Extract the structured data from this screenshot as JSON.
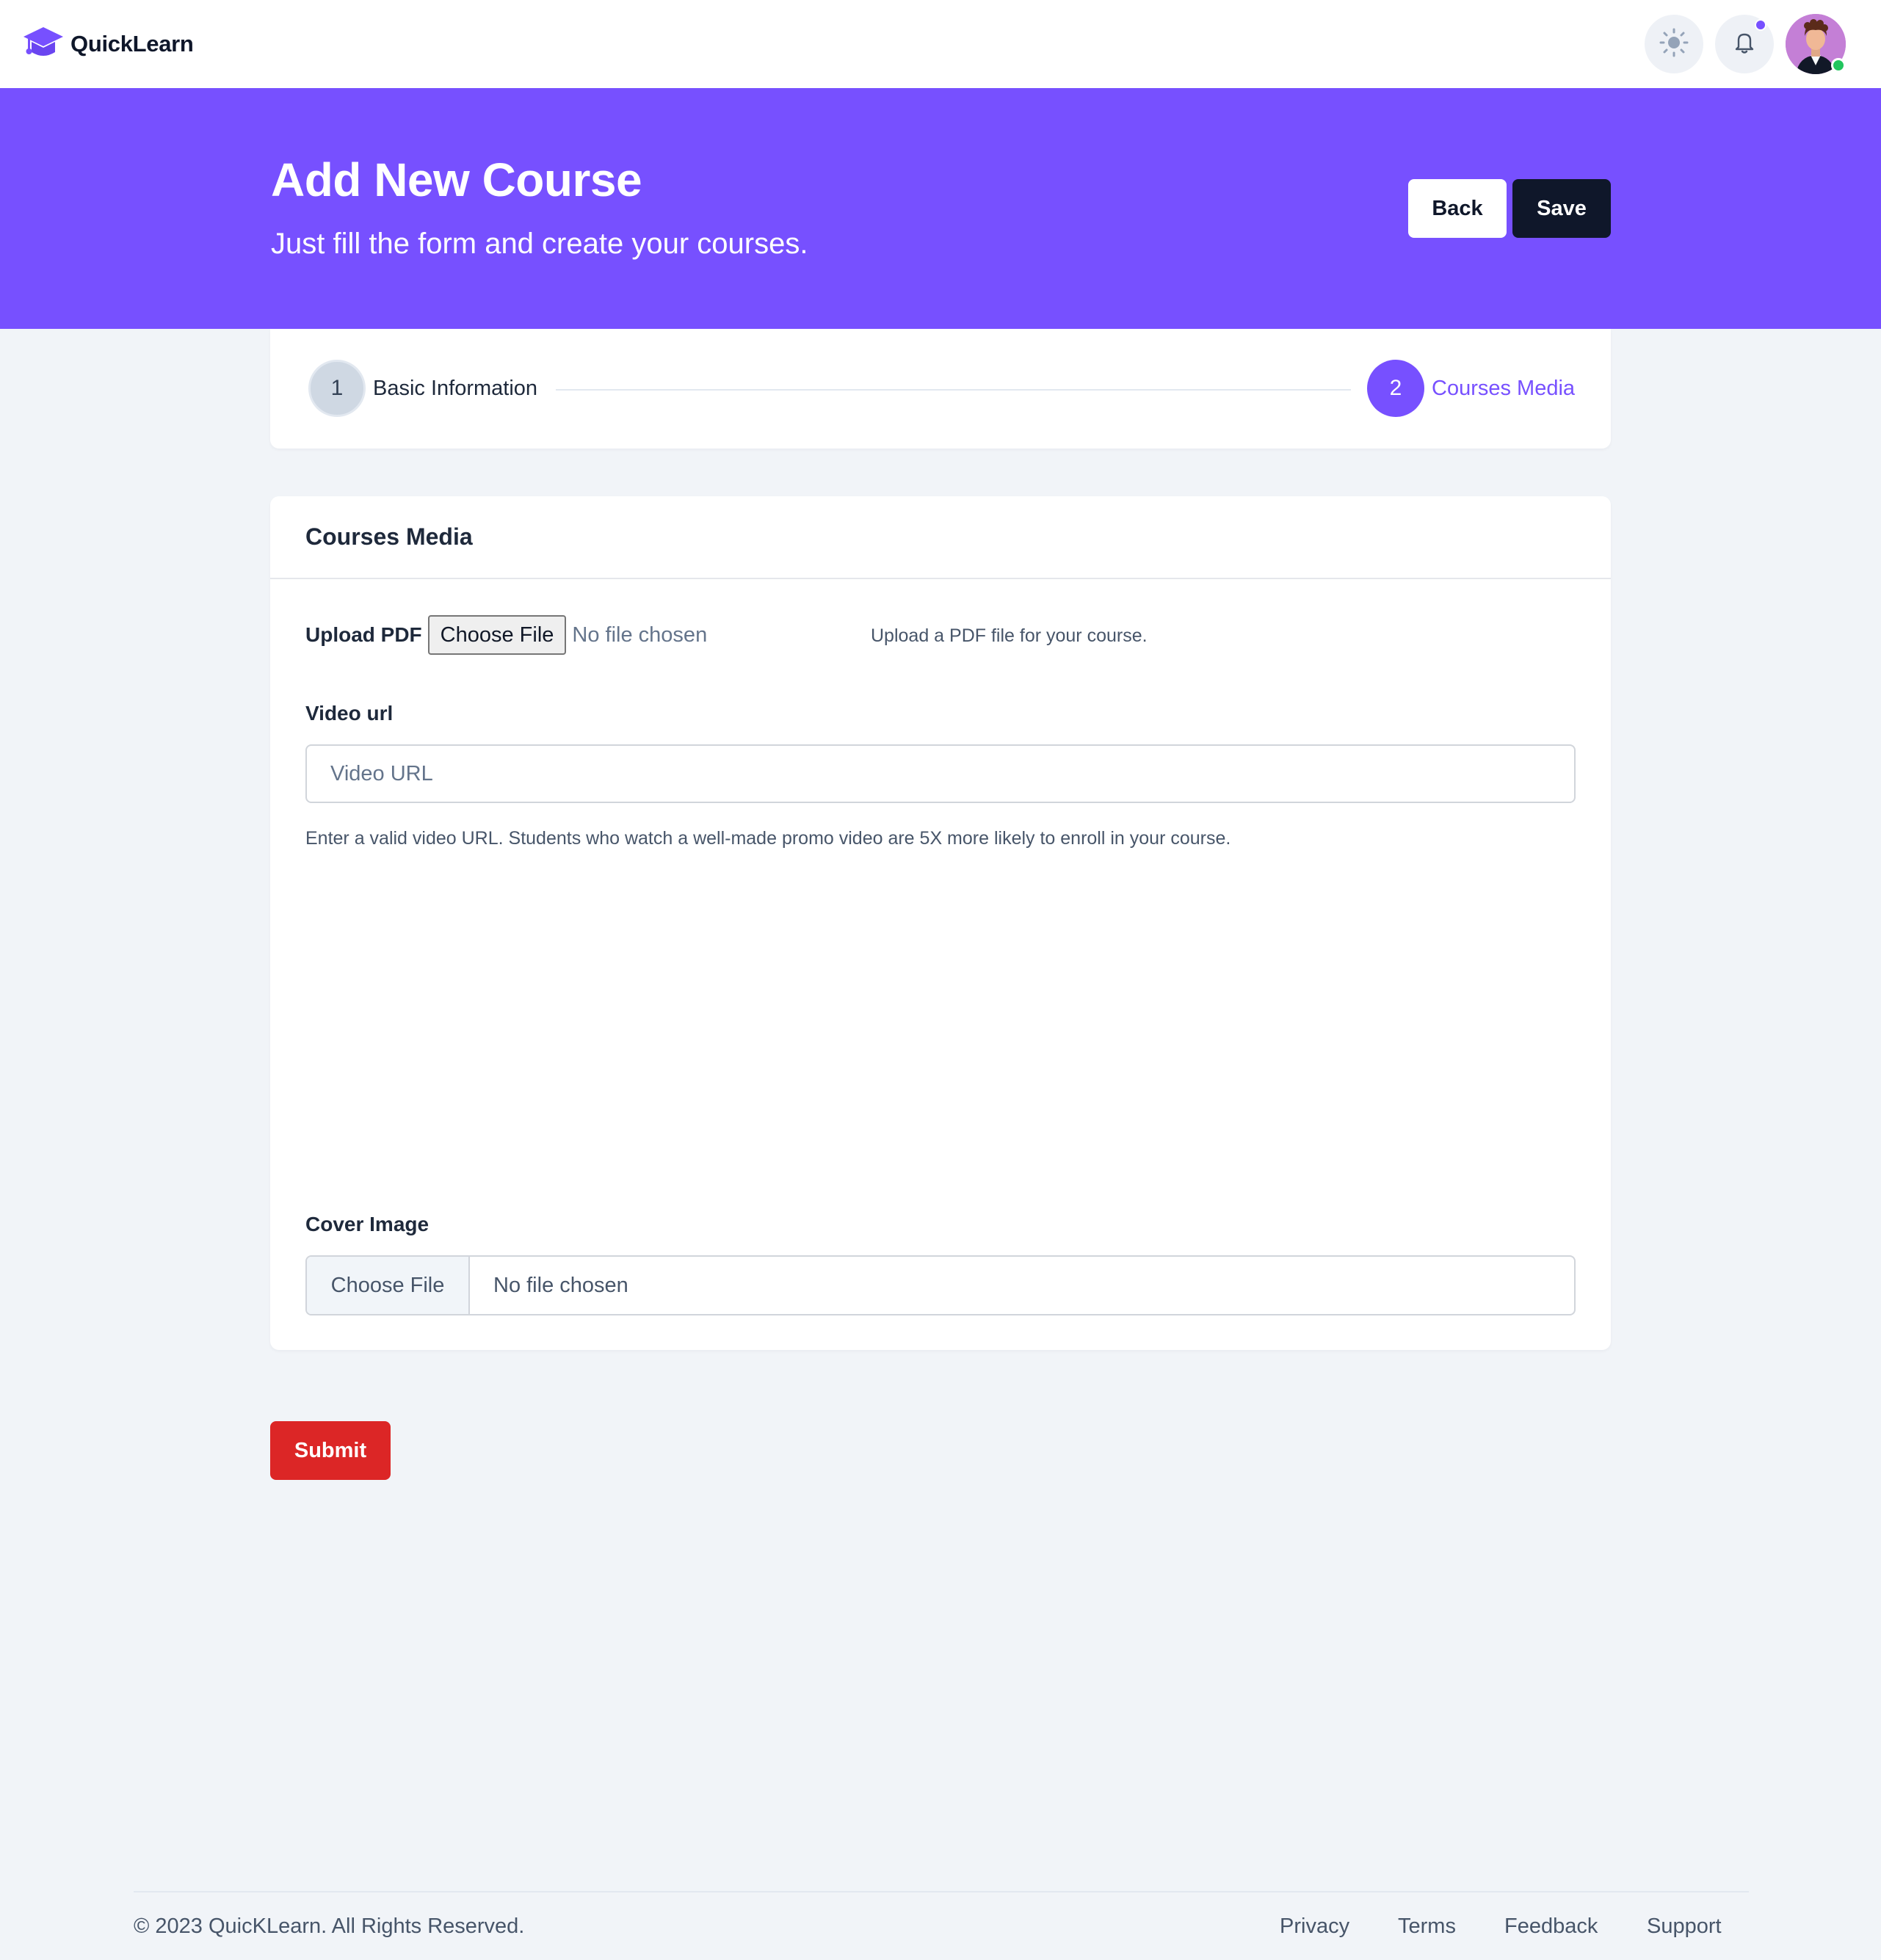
{
  "brand": {
    "name": "QuickLearn",
    "color": "#7750ff"
  },
  "navbar": {
    "theme_icon": "sun-icon",
    "notification_icon": "bell-icon",
    "has_notification": true,
    "avatar_online": true
  },
  "hero": {
    "title": "Add New Course",
    "subtitle": "Just fill the form and create your courses.",
    "back_label": "Back",
    "save_label": "Save",
    "background": "#7750ff"
  },
  "stepper": {
    "steps": [
      {
        "number": "1",
        "label": "Basic Information",
        "active": false
      },
      {
        "number": "2",
        "label": "Courses Media",
        "active": true
      }
    ]
  },
  "media_card": {
    "title": "Courses Media",
    "upload_pdf": {
      "label": "Upload PDF",
      "button": "Choose File",
      "status": "No file chosen",
      "help": "Upload a PDF file for your course."
    },
    "video_url": {
      "label": "Video url",
      "placeholder": "Video URL",
      "value": "",
      "help": "Enter a valid video URL. Students who watch a well-made promo video are 5X more likely to enroll in your course."
    },
    "cover_image": {
      "label": "Cover Image",
      "button": "Choose File",
      "status": "No file chosen"
    }
  },
  "submit_label": "Submit",
  "footer": {
    "copyright": "© 2023 QuicKLearn. All Rights Reserved.",
    "links": [
      "Privacy",
      "Terms",
      "Feedback",
      "Support"
    ]
  }
}
